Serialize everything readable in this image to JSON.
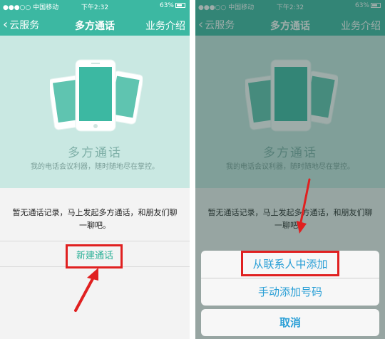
{
  "status": {
    "carrier": "●●●○○ 中国移动",
    "time": "下午2:32",
    "battery": "63%"
  },
  "nav": {
    "back_label": "云服务",
    "title": "多方通话",
    "about_label": "业务介绍"
  },
  "hero": {
    "title": "多方通话",
    "subtitle": "我的电话会议利器，随时随地尽在掌控。"
  },
  "empty_state": {
    "text": "暂无通话记录，马上发起多方通话，和朋友们聊一聊吧。"
  },
  "new_call_label": "新建通话",
  "action_sheet": {
    "add_from_contacts": "从联系人中添加",
    "manual_add": "手动添加号码",
    "cancel": "取消"
  },
  "colors": {
    "accent": "#3cb8a2",
    "highlight": "#e02020",
    "sheet_text": "#2a9fd6"
  }
}
